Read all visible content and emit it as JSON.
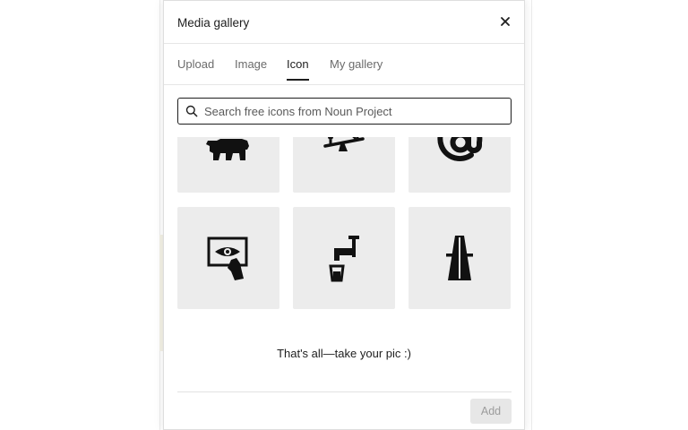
{
  "modal": {
    "title": "Media gallery",
    "close_icon": "close-icon"
  },
  "tabs": [
    {
      "label": "Upload",
      "active": false
    },
    {
      "label": "Image",
      "active": false
    },
    {
      "label": "Icon",
      "active": true
    },
    {
      "label": "My gallery",
      "active": false
    }
  ],
  "search": {
    "placeholder": "Search free icons from Noun Project",
    "value": "",
    "icon": "search-icon"
  },
  "icons": [
    {
      "name": "bear-icon"
    },
    {
      "name": "seesaw-icon"
    },
    {
      "name": "at-sign-icon"
    },
    {
      "name": "eye-screen-hand-icon"
    },
    {
      "name": "water-tap-cup-icon"
    },
    {
      "name": "highway-icon"
    }
  ],
  "end_message": "That's all—take your pic :)",
  "footer": {
    "add_label": "Add",
    "add_enabled": false
  },
  "colors": {
    "tile_bg": "#ececec",
    "text": "#1e1e1e",
    "muted_text": "#6b6b6b",
    "disabled_button_bg": "#e7e7e7"
  }
}
